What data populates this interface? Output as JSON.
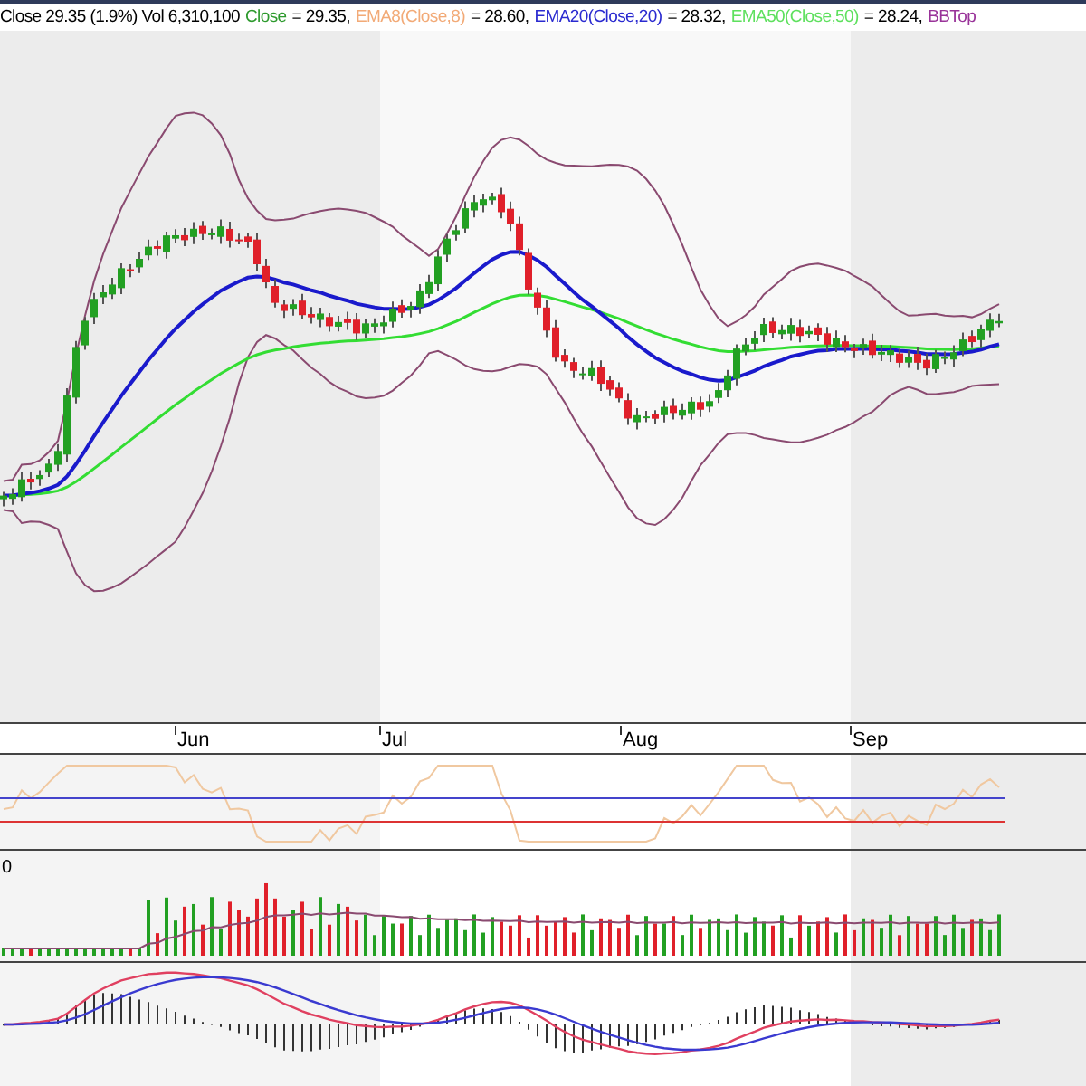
{
  "header": {
    "quote": "Close 29.35 (1.9%) Vol 6,310,100",
    "legend": [
      {
        "label": "Close",
        "value": "= 29.35,",
        "color": "#2e9a2e"
      },
      {
        "label": "EMA8(Close,8)",
        "value": "= 28.60,",
        "color": "#f2aa77"
      },
      {
        "label": "EMA20(Close,20)",
        "value": "= 28.32,",
        "color": "#2a2ad0"
      },
      {
        "label": "EMA50(Close,50)",
        "value": "= 28.24,",
        "color": "#5ee05e"
      },
      {
        "label": "BBTop",
        "color": "#993399"
      }
    ]
  },
  "time_axis": {
    "months": [
      "Jun",
      "Jul",
      "Aug",
      "Sep"
    ]
  },
  "volume_panel": {
    "axis_label": "0"
  }
}
